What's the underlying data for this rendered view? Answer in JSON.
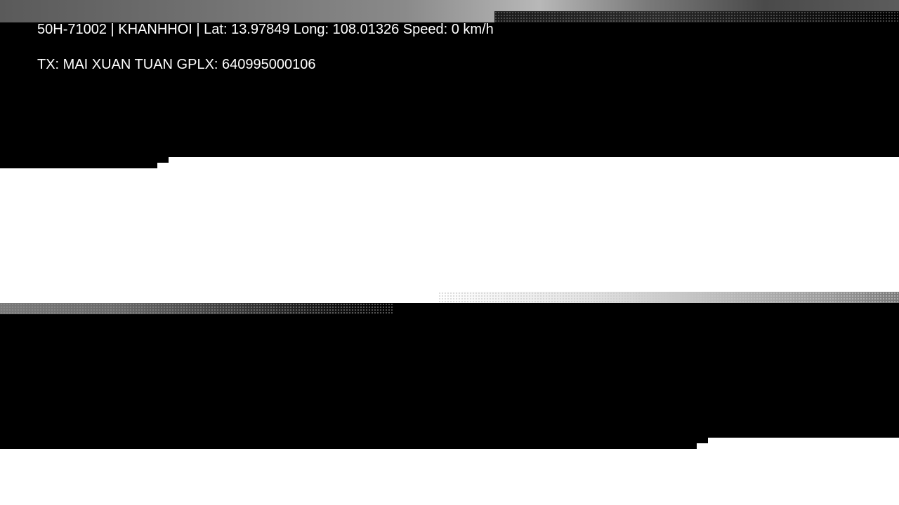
{
  "overlay": {
    "line1": "50H-71002 | KHANHHOI | Lat: 13.97849 Long: 108.01326 Speed: 0 km/h",
    "line2": "TX: MAI XUAN TUAN GPLX: 640995000106"
  },
  "colors": {
    "overlay_text": "#ffffff",
    "mask": "#000000",
    "background": "#ffffff"
  }
}
